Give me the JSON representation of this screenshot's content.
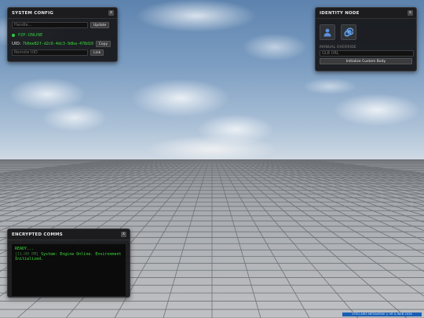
{
  "system_config": {
    "title": "SYSTEM CONFIG",
    "close_label": "x",
    "handle_placeholder": "Handle...",
    "update_label": "Update",
    "status_text": "P2P: ONLINE",
    "status_color": "#2ecc40",
    "uid_label": "UID:",
    "uid_value": "7b6ee82f-d2c6-4dc3-9dba-478d10cf5ac6",
    "copy_label": "Copy",
    "remote_uid_placeholder": "Remote UID",
    "link_label": "Link"
  },
  "identity_node": {
    "title": "IDENTITY NODE",
    "close_label": "x",
    "avatar_icons": [
      "person-icon",
      "spiral-icon"
    ],
    "manual_override_label": "MANUAL OVERRIDE",
    "glb_placeholder": "GLB URL",
    "init_button_label": "Initialize Custom Body"
  },
  "encrypted_comms": {
    "title": "ENCRYPTED COMMS",
    "close_label": "x",
    "ready_line": "READY...",
    "log_time": "[11:00 PM]",
    "log_message": "System: Engine Online. Environment Initialized."
  },
  "footer": {
    "badge_text": "STELLARIS METAVERSE // VR & WEB 2026"
  },
  "colors": {
    "accent_green": "#3ddc3d",
    "footer_blue": "#1a5fb4"
  }
}
